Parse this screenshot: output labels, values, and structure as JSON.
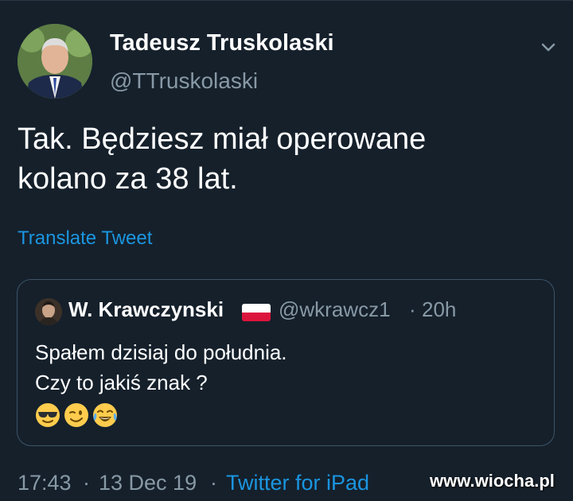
{
  "tweet": {
    "author": {
      "display_name": "Tadeusz Truskolaski",
      "handle": "@TTruskolaski",
      "avatar_icon": "profile-photo"
    },
    "menu_icon": "chevron-down-icon",
    "text_lines": [
      "Tak. Będziesz miał operowane",
      "kolano za 38 lat."
    ],
    "translate_label": "Translate Tweet",
    "quoted": {
      "display_name": "W. Krawczynski",
      "flag_icon": "poland-flag-icon",
      "handle": "@wkrawcz1",
      "separator": "·",
      "time": "20h",
      "text_lines": [
        "Spałem dzisiaj do południa.",
        "Czy to jakiś znak ?"
      ],
      "emojis": [
        "sunglasses-emoji",
        "winking-emoji",
        "tears-of-joy-emoji"
      ]
    },
    "footer": {
      "time": "17:43",
      "separator": "·",
      "date": "13 Dec 19",
      "source": "Twitter for iPad"
    }
  },
  "watermark": "www.wiocha.pl",
  "colors": {
    "background": "#15202b",
    "secondary_text": "#8899a6",
    "link": "#1b95e0",
    "border": "#3d5466"
  }
}
